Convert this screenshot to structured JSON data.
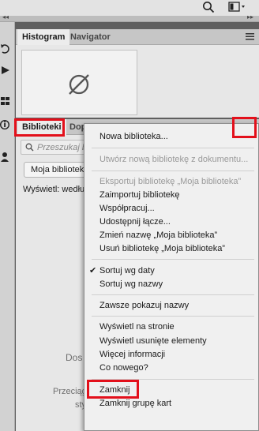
{
  "panel1": {
    "tabs": [
      "Histogram",
      "Navigator"
    ]
  },
  "panel2": {
    "tabs": [
      "Biblioteki",
      "Dop"
    ],
    "search_placeholder": "Przeszukaj bi",
    "library_select": "Moja bibliotek",
    "show_text": "Wyświetl: według",
    "bottom_line1": "Dos",
    "bottom_line2": "Przeciąg",
    "bottom_line3": "sty"
  },
  "menu": {
    "items": [
      "Nowa biblioteka...",
      "Utwórz nową bibliotekę z dokumentu...",
      "Eksportuj bibliotekę „Moja biblioteka”",
      "Zaimportuj bibliotekę",
      "Współpracuj...",
      "Udostępnij łącze...",
      "Zmień nazwę „Moja biblioteka”",
      "Usuń bibliotekę „Moja biblioteka”",
      "Sortuj wg daty",
      "Sortuj wg nazwy",
      "Zawsze pokazuj nazwy",
      "Wyświetl na stronie",
      "Wyświetl usunięte elementy",
      "Więcej informacji",
      "Co nowego?",
      "Zamknij",
      "Zamknij grupę kart"
    ],
    "checked_item": "Sortuj wg daty",
    "disabled_items": [
      "Utwórz nową bibliotekę z dokumentu...",
      "Eksportuj bibliotekę „Moja biblioteka”"
    ]
  },
  "colors": {
    "highlight": "#e3101b",
    "panel_bg": "#e7e7e7",
    "menu_bg": "#f0f0f0"
  }
}
